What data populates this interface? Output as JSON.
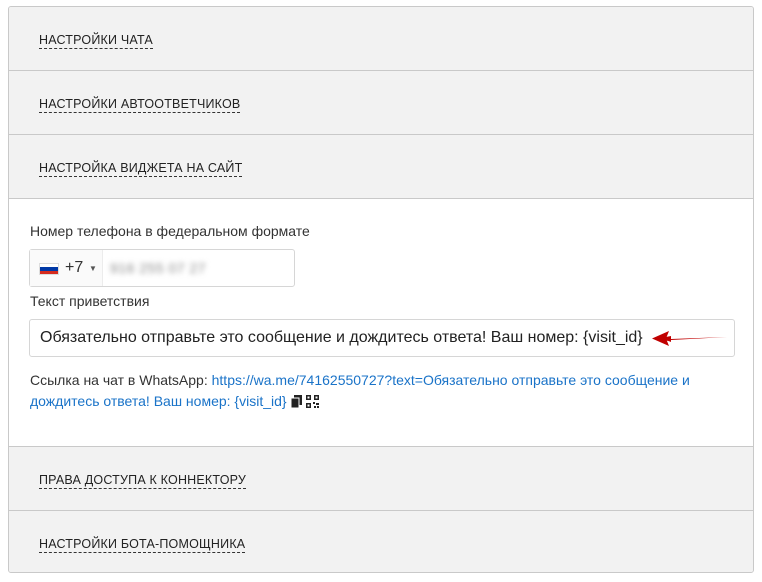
{
  "sections": {
    "chat_settings": "НАСТРОЙКИ ЧАТА",
    "autoresponders": "НАСТРОЙКИ АВТООТВЕТЧИКОВ",
    "widget": "НАСТРОЙКА ВИДЖЕТА НА САЙТ",
    "access_rights": "ПРАВА ДОСТУПА К КОННЕКТОРУ",
    "bot_settings": "НАСТРОЙКИ БОТА-ПОМОЩНИКА"
  },
  "widget": {
    "phone_label": "Номер телефона в федеральном формате",
    "country_code": "+7",
    "phone_value": "916 255 07 27",
    "greeting_label": "Текст приветствия",
    "greeting_value": "Обязательно отправьте это сообщение и дождитесь ответа! Ваш номер: {visit_id}",
    "link_label": "Ссылка на чат в WhatsApp:",
    "link_url_part1": "https://wa.me/74162550727?text=Обязательно отправьте это сообщение и",
    "link_url_part2": "дождитесь ответа! Ваш номер: {visit_id}"
  },
  "icons": {
    "flag": "russia-flag-icon",
    "caret": "caret-down-icon",
    "copy": "copy-icon",
    "qr": "qr-code-icon",
    "arrow": "red-arrow-annotation"
  },
  "colors": {
    "link": "#1a73c8",
    "arrow": "#c00000",
    "header_bg": "#f2f2f2"
  }
}
